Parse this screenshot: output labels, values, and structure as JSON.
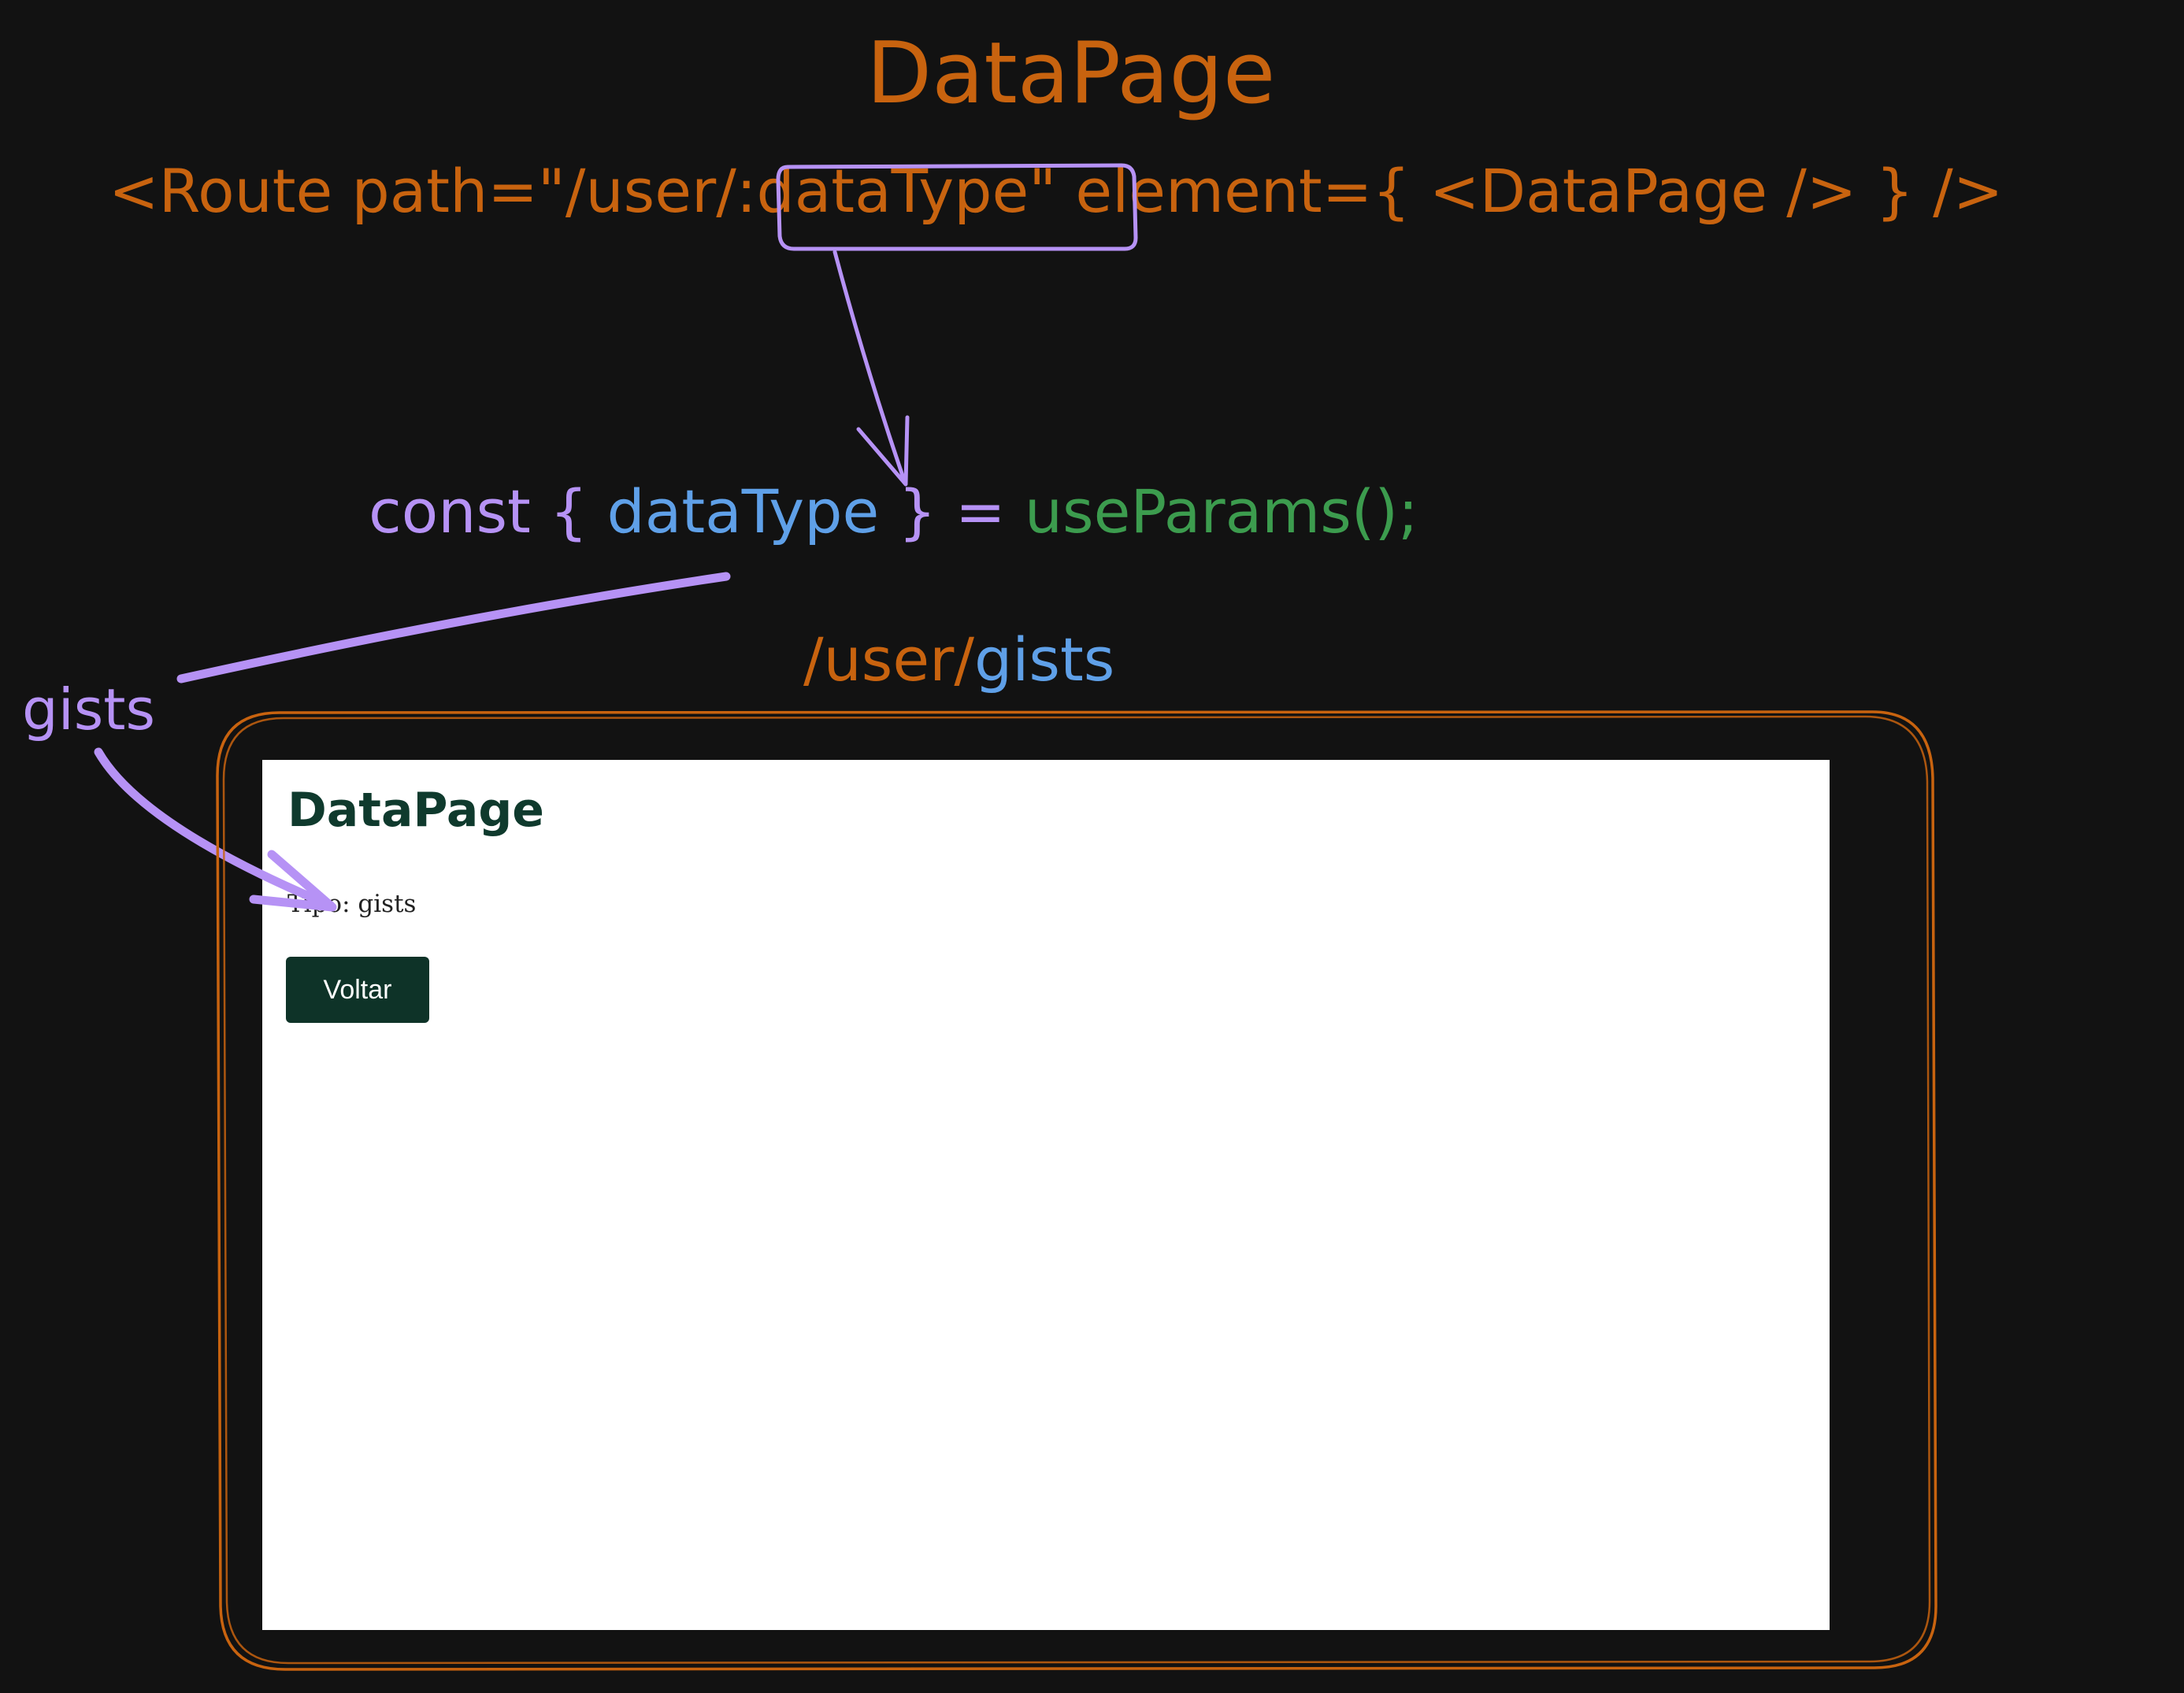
{
  "diagram": {
    "title": "DataPage",
    "route": {
      "prefix": "<Route path=\"/user/",
      "param": ":dataType",
      "suffix": "\" element={ <DataPage /> } />"
    },
    "hook": {
      "const_kw": "const {",
      "param_name": "dataType",
      "close_brace": "} =",
      "call": "useParams();"
    },
    "url": {
      "prefix": "/user/",
      "value": "gists"
    },
    "note_value": "gists"
  },
  "screenshot": {
    "page_title": "DataPage",
    "tipo_text": "Tipo: gists",
    "back_button_label": "Voltar"
  },
  "colors": {
    "background": "#121212",
    "orange": "#c8630f",
    "purple": "#b692f5",
    "blue": "#5fa0e8",
    "green": "#3c9c4e",
    "screen_title": "#0f3a2d",
    "button_bg": "#0e3328"
  }
}
